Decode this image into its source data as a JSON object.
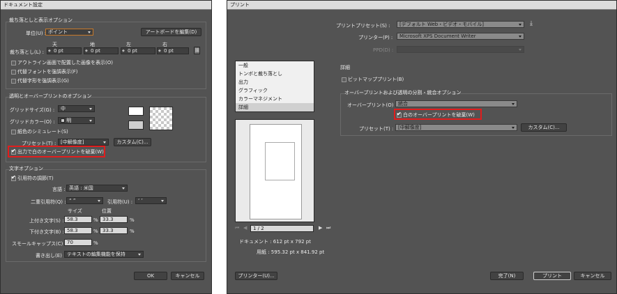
{
  "doc_dialog": {
    "title": "ドキュメント設定",
    "bleed_group": {
      "title": "裁ち落としと表示オプション",
      "unit_label": "単位(U) :",
      "unit_value": "ポイント",
      "edit_artboards_button": "アートボードを編集(D)",
      "col_top": "天",
      "col_bottom": "地",
      "col_left": "左",
      "col_right": "右",
      "bleed_label": "裁ち落とし(L) :",
      "bleed_top": "0 pt",
      "bleed_bottom": "0 pt",
      "bleed_left": "0 pt",
      "bleed_right": "0 pt",
      "outline_images": "アウトライン画面で配置した画像を表示(O)",
      "highlight_fonts": "代替フォントを強調表示(F)",
      "highlight_glyphs": "代替字形を強調表示(G)"
    },
    "transparency_group": {
      "title": "透明とオーバープリントのオプション",
      "grid_size_label": "グリッドサイズ(G) :",
      "grid_size_value": "中",
      "grid_color_label": "グリッドカラー(O) :",
      "grid_color_value": "明",
      "simulate_paper": "紙色のシミュレート(S)",
      "preset_label": "プリセット(T) :",
      "preset_value": "[中解像度]",
      "custom_button": "カスタム(C)...",
      "discard_white_overprint": "出力で白のオーバープリントを破棄(W)",
      "discard_white_overprint_checked": true
    },
    "type_group": {
      "title": "文字オプション",
      "use_typo_quotes": "引用符の調節(T)",
      "use_typo_quotes_checked": true,
      "language_label": "言語 :",
      "language_value": "英語 : 米国",
      "double_quotes_label": "二重引用符(Q) :",
      "double_quotes_value": "“ ”",
      "single_quotes_label": "引用符(U) :",
      "single_quotes_value": "‘ ’",
      "col_size": "サイズ",
      "col_position": "位置",
      "superscript_label": "上付き文字(S) :",
      "superscript_size": "58.3",
      "superscript_position": "33.3",
      "subscript_label": "下付き文字(B) :",
      "subscript_size": "58.3",
      "subscript_position": "33.3",
      "smallcaps_label": "スモールキャップス(C) :",
      "smallcaps_value": "70",
      "percent": "%",
      "export_label": "書き出し(E) :",
      "export_value": "テキストの編集機能を保持"
    },
    "ok_button": "OK",
    "cancel_button": "キャンセル"
  },
  "print_dialog": {
    "title": "プリント",
    "print_preset_label": "プリントプリセット(S) :",
    "print_preset_value": "[デフォルト Web・ビデオ・モバイル]",
    "printer_label": "プリンター(P) :",
    "printer_value": "Microsoft XPS Document Writer",
    "ppd_label": "PPD(D) :",
    "categories": [
      {
        "label": "一般",
        "selected": false
      },
      {
        "label": "トンボと裁ち落とし",
        "selected": false
      },
      {
        "label": "出力",
        "selected": false
      },
      {
        "label": "グラフィック",
        "selected": false
      },
      {
        "label": "カラーマネジメント",
        "selected": false
      },
      {
        "label": "詳細",
        "selected": true
      }
    ],
    "advanced_heading": "詳細",
    "bitmap_printing": "ビットマッププリント(B)",
    "overprint_group_title": "オーバープリントおよび透明の分割・統合オプション",
    "overprint_label": "オーバープリント(O) :",
    "overprint_value": "統合",
    "discard_white_overprint": "白のオーバープリントを破棄(W)",
    "discard_white_overprint_checked": true,
    "preset_label": "プリセット(T) :",
    "preset_value": "[中解像度]",
    "custom_button": "カスタム(C)...",
    "page_indicator": "1 / 2",
    "doc_info": "ドキュメント : 612 pt x 792 pt",
    "media_info": "用紙 : 595.32 pt x 841.92 pt",
    "printer_button": "プリンター(U)...",
    "done_button": "完了(N)",
    "print_button": "プリント",
    "cancel_button": "キャンセル"
  },
  "colors": {
    "highlight": "#e21d1d",
    "dialog_bg": "#535353"
  }
}
